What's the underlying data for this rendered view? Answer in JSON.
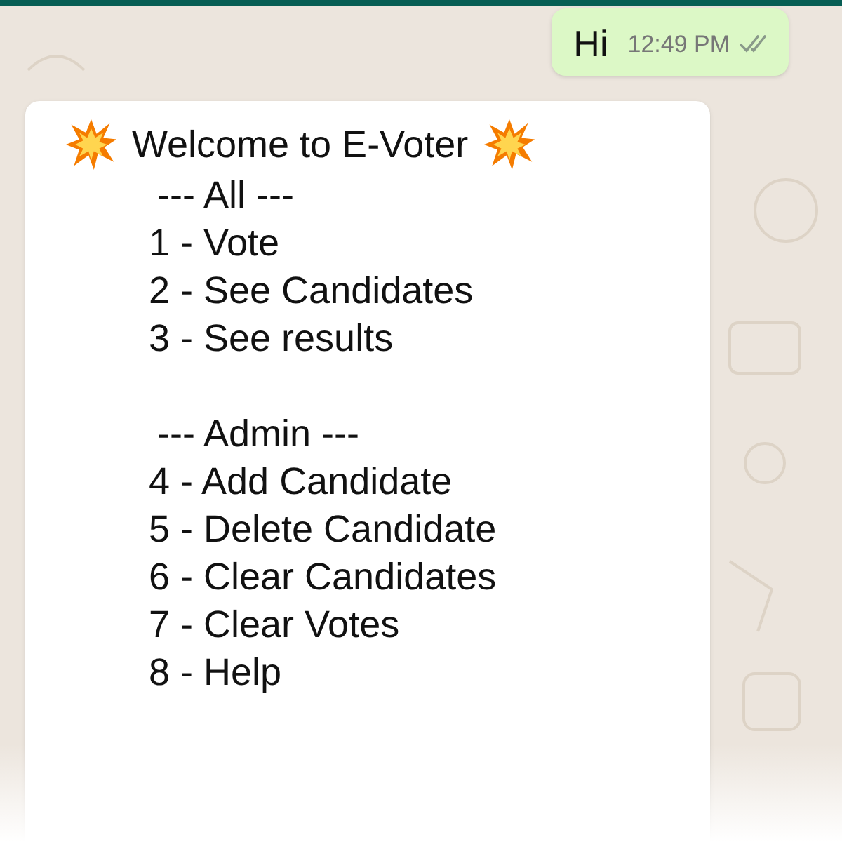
{
  "outgoing_message": {
    "text": "Hi",
    "time": "12:49 PM",
    "read": false
  },
  "incoming_message": {
    "title": "Welcome to E-Voter",
    "sections": [
      {
        "heading": "--- All ---",
        "items": [
          "1 - Vote",
          "2 - See Candidates",
          "3 - See results"
        ]
      },
      {
        "heading": "--- Admin ---",
        "items": [
          "4 - Add Candidate",
          "5 - Delete Candidate",
          "6 - Clear Candidates",
          "7 - Clear Votes",
          "8 - Help"
        ]
      }
    ]
  }
}
